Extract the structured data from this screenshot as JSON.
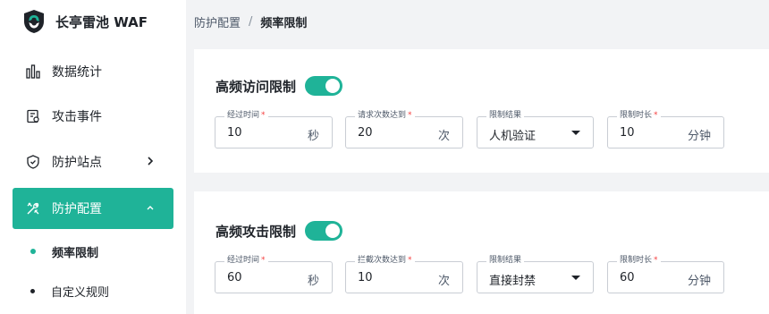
{
  "app": {
    "name": "长亭雷池 WAF"
  },
  "colors": {
    "accent": "#1fb398"
  },
  "sidebar": {
    "items": [
      {
        "label": "数据统计",
        "icon": "bar-chart-icon"
      },
      {
        "label": "攻击事件",
        "icon": "document-list-icon"
      },
      {
        "label": "防护站点",
        "icon": "shield-icon"
      },
      {
        "label": "防护配置",
        "icon": "tools-icon",
        "active": true
      },
      {
        "label": "频率限制",
        "sub": true,
        "current": true
      },
      {
        "label": "自定义规则",
        "sub": true
      }
    ]
  },
  "breadcrumb": {
    "parent": "防护配置",
    "separator": "/",
    "current": "频率限制"
  },
  "sections": [
    {
      "title": "高频访问限制",
      "enabled": true,
      "fields": {
        "time": {
          "label": "经过时间",
          "value": "10",
          "unit": "秒"
        },
        "count": {
          "label": "请求次数达到",
          "value": "20",
          "unit": "次"
        },
        "result": {
          "label": "限制结果",
          "value": "人机验证"
        },
        "duration": {
          "label": "限制时长",
          "value": "10",
          "unit": "分钟"
        }
      }
    },
    {
      "title": "高频攻击限制",
      "enabled": true,
      "fields": {
        "time": {
          "label": "经过时间",
          "value": "60",
          "unit": "秒"
        },
        "count": {
          "label": "拦截次数达到",
          "value": "10",
          "unit": "次"
        },
        "result": {
          "label": "限制结果",
          "value": "直接封禁"
        },
        "duration": {
          "label": "限制时长",
          "value": "60",
          "unit": "分钟"
        }
      }
    }
  ],
  "required_mark": "*"
}
